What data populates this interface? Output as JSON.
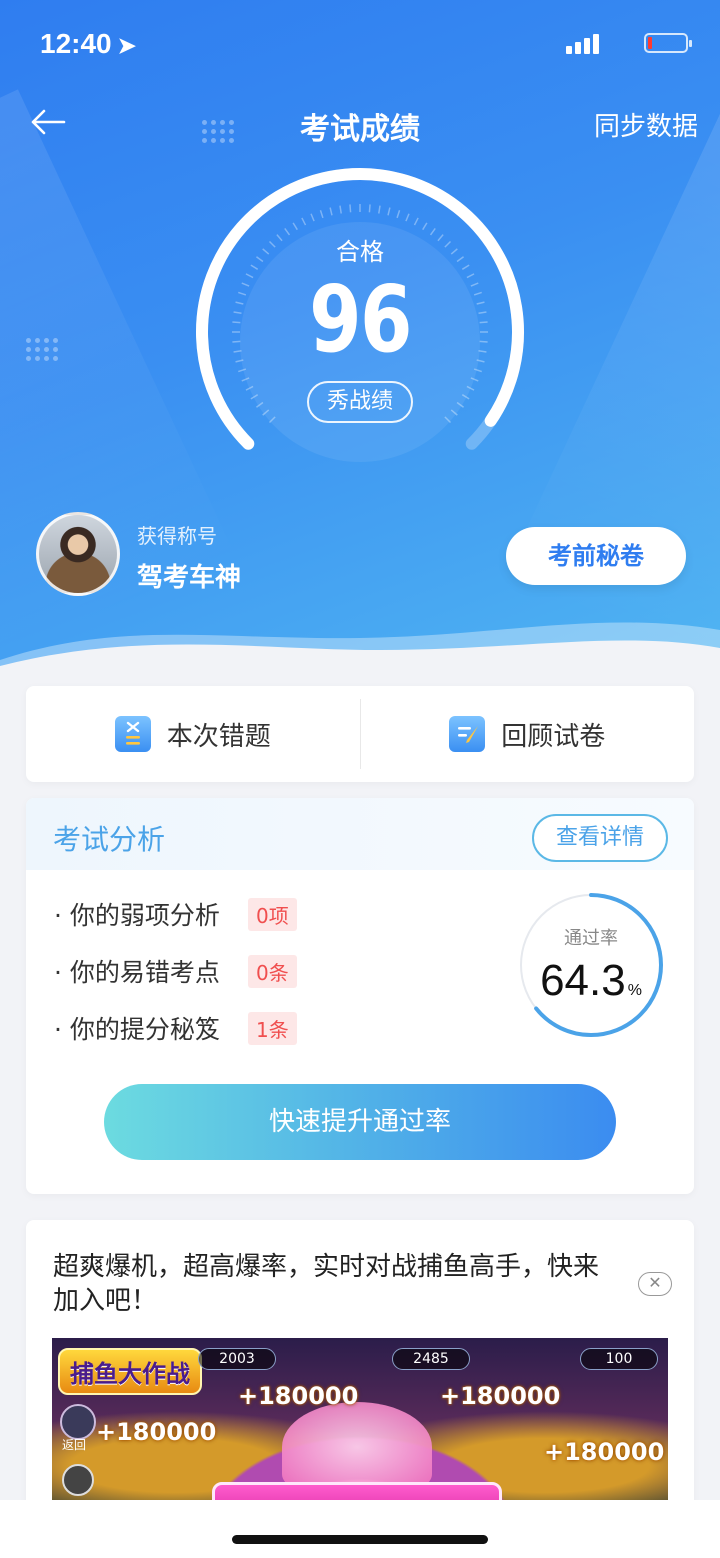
{
  "status_bar": {
    "time": "12:40"
  },
  "nav": {
    "title": "考试成绩",
    "sync_label": "同步数据"
  },
  "result": {
    "grade": "合格",
    "score": "96",
    "show_label": "秀战绩",
    "score_max": 100
  },
  "profile": {
    "title_label": "获得称号",
    "title_value": "驾考车神",
    "secret_button": "考前秘卷"
  },
  "actions": [
    {
      "label": "本次错题",
      "icon": "wrong-questions-icon"
    },
    {
      "label": "回顾试卷",
      "icon": "review-paper-icon"
    }
  ],
  "analysis": {
    "title": "考试分析",
    "detail_button": "查看详情",
    "items": [
      {
        "label": "· 你的弱项分析",
        "badge": "0项"
      },
      {
        "label": "· 你的易错考点",
        "badge": "0条"
      },
      {
        "label": "· 你的提分秘笈",
        "badge": "1条"
      }
    ],
    "pass_rate_label": "通过率",
    "pass_rate_value": "64.3",
    "pass_rate_unit": "%",
    "boost_button": "快速提升通过率"
  },
  "ad": {
    "text": "超爽爆机，超高爆率，实时对战捕鱼高手，快来加入吧！",
    "logo": "捕鱼大作战",
    "amount": "+180000",
    "back_label": "返回",
    "counters": [
      "2003",
      "2485",
      "100"
    ]
  },
  "colors": {
    "primary": "#2f7df0",
    "accent": "#4ba3e8",
    "badge_red": "#f04f4f"
  }
}
